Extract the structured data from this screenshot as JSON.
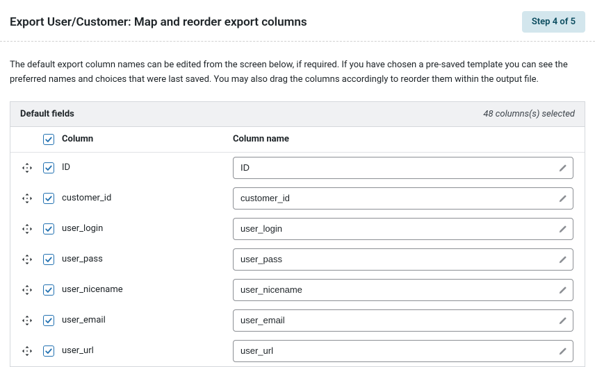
{
  "header": {
    "title": "Export User/Customer: Map and reorder export columns",
    "step": "Step 4 of 5"
  },
  "description": "The default export column names can be edited from the screen below, if required. If you have chosen a pre-saved template you can see the preferred names and choices that were last saved. You may also drag the columns accordingly to reorder them within the output file.",
  "section": {
    "title": "Default fields",
    "meta": "48 columns(s) selected"
  },
  "thead": {
    "column": "Column",
    "column_name": "Column name"
  },
  "rows": [
    {
      "field": "ID",
      "name": "ID"
    },
    {
      "field": "customer_id",
      "name": "customer_id"
    },
    {
      "field": "user_login",
      "name": "user_login"
    },
    {
      "field": "user_pass",
      "name": "user_pass"
    },
    {
      "field": "user_nicename",
      "name": "user_nicename"
    },
    {
      "field": "user_email",
      "name": "user_email"
    },
    {
      "field": "user_url",
      "name": "user_url"
    }
  ]
}
